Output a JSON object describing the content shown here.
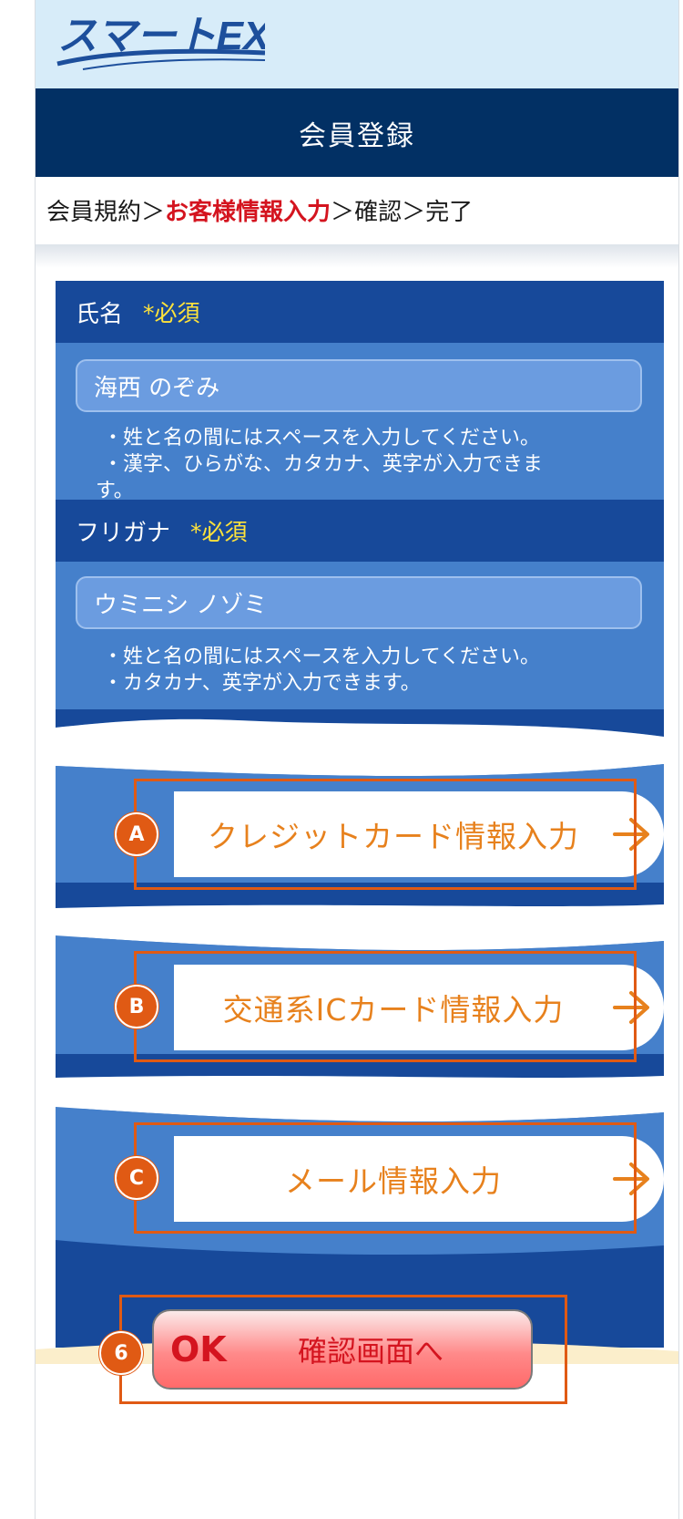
{
  "header": {
    "logo_text": "スマートEX",
    "title": "会員登録"
  },
  "breadcrumb": {
    "step1": "会員規約",
    "sep1": "＞",
    "step2": "お客様情報入力",
    "sep2": "＞",
    "step3": "確認",
    "sep3": "＞",
    "step4": "完了"
  },
  "name_section": {
    "label": "氏名",
    "required": "*必須",
    "value": "海西 のぞみ",
    "note1": "・姓と名の間にはスペースを入力してください。",
    "note2": "・漢字、ひらがな、カタカナ、英字が入力できま",
    "note3": "す。"
  },
  "kana_section": {
    "label": "フリガナ",
    "required": "*必須",
    "value": "ウミニシ ノゾミ",
    "note1": "・姓と名の間にはスペースを入力してください。",
    "note2": "・カタカナ、英字が入力できます。"
  },
  "buttons": {
    "credit": {
      "label": "クレジットカード情報入力",
      "badge": "A"
    },
    "ic": {
      "label": "交通系ICカード情報入力",
      "badge": "B"
    },
    "mail": {
      "label": "メール情報入力",
      "badge": "C"
    }
  },
  "confirm": {
    "ok": "OK",
    "label": "確認画面へ",
    "badge": "6"
  },
  "colors": {
    "navy": "#023064",
    "panel": "#4580cb",
    "section_head": "#17499a",
    "accent_orange": "#e7811d",
    "highlight": "#e05a14",
    "required_yellow": "#ffe33a",
    "current_step_red": "#d4141f"
  },
  "icons": {
    "arrow": "arrow-right-icon"
  }
}
